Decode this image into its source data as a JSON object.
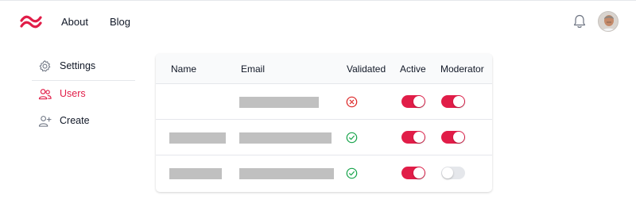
{
  "nav": {
    "about": "About",
    "blog": "Blog",
    "logo_icon": "wave-logo-icon",
    "notification_icon": "bell-icon"
  },
  "sidebar": {
    "items": [
      {
        "label": "Settings",
        "icon": "gear-icon",
        "active": false
      },
      {
        "label": "Users",
        "icon": "users-icon",
        "active": true
      },
      {
        "label": "Create",
        "icon": "user-plus-icon",
        "active": false
      }
    ]
  },
  "table": {
    "columns": [
      "Name",
      "Email",
      "Validated",
      "Active",
      "Moderator"
    ],
    "rows": [
      {
        "name": "",
        "email": "",
        "validated": false,
        "active": true,
        "moderator": true
      },
      {
        "name": "",
        "email": "",
        "validated": true,
        "active": true,
        "moderator": true
      },
      {
        "name": "",
        "email": "",
        "validated": true,
        "active": true,
        "moderator": false
      }
    ]
  },
  "colors": {
    "accent": "#e11d48",
    "valid": "#16a34a",
    "invalid": "#dc2626",
    "redacted": "#c0c0c0"
  }
}
